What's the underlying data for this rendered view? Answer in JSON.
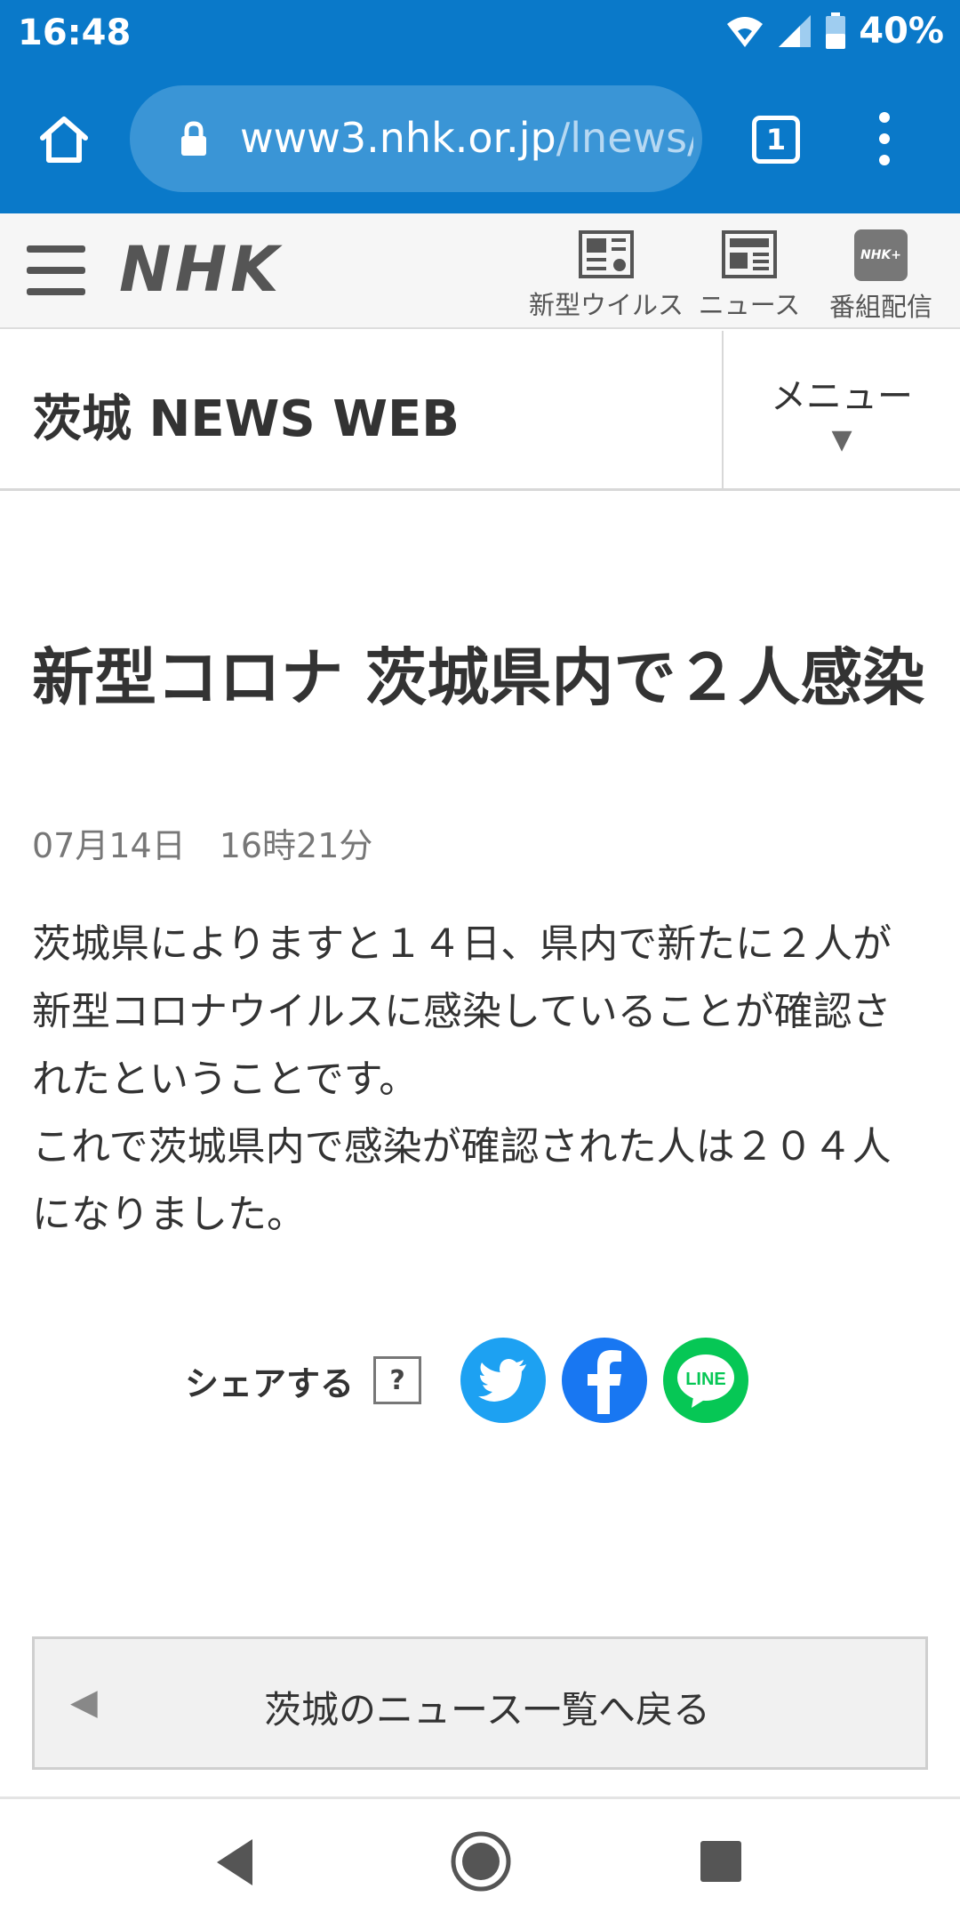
{
  "status_bar": {
    "time": "16:48",
    "battery": "40%",
    "icons": [
      "wifi-icon",
      "signal-icon",
      "battery-icon"
    ]
  },
  "browser": {
    "url_main": "www3.nhk.or.jp",
    "url_path": "/lnews/",
    "tab_count": "1"
  },
  "site_header": {
    "logo": "NHK",
    "nav": [
      {
        "label": "新型ウイルス",
        "icon": "virus-news-icon"
      },
      {
        "label": "ニュース",
        "icon": "newspaper-icon"
      },
      {
        "label": "番組配信",
        "icon": "nhk-plus-icon",
        "icon_text": "NHK+"
      }
    ]
  },
  "local_header": {
    "title": "茨城 NEWS WEB",
    "menu_label": "メニュー",
    "menu_caret": "▼"
  },
  "article": {
    "title": "新型コロナ 茨城県内で２人感染",
    "date": "07月14日　16時21分",
    "paragraphs": [
      "茨城県によりますと１４日、県内で新たに２人が新型コロナウイルスに感染していることが確認されたということです。",
      "これで茨城県内で感染が確認された人は２０４人になりました。"
    ]
  },
  "share": {
    "label": "シェアする",
    "help": "?",
    "line_text": "LINE"
  },
  "back": {
    "caret": "◀",
    "label": "茨城のニュース一覧へ戻る"
  },
  "colors": {
    "chrome": "#0a79c9",
    "twitter": "#1da1f2",
    "facebook": "#1877f2",
    "line": "#06c755"
  }
}
